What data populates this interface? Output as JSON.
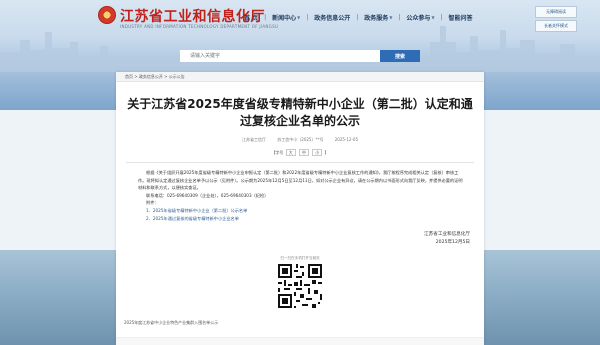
{
  "header": {
    "site_title": "江苏省工业和信息化厅",
    "site_subtitle": "INDUSTRY AND INFORMATION TECHNOLOGY DEPARTMENT OF JIANGSU",
    "nav": [
      {
        "label": "首 页",
        "has_caret": false
      },
      {
        "label": "新闻中心",
        "has_caret": true
      },
      {
        "label": "政务信息公开",
        "has_caret": false
      },
      {
        "label": "政务服务",
        "has_caret": true
      },
      {
        "label": "公众参与",
        "has_caret": true
      },
      {
        "label": "智能问答",
        "has_caret": false
      }
    ],
    "quick_links": [
      "无障碍阅读",
      "长者关怀模式"
    ]
  },
  "search": {
    "placeholder": "请输入关键字",
    "button_label": "搜索"
  },
  "breadcrumb": "首页 > 政务信息公开 > 公示公告",
  "article": {
    "title": "关于江苏省2025年度省级专精特新中小企业（第二批）认定和通过复核企业名单的公示",
    "source": "江苏省工信厅",
    "doc_no": "苏工信中小〔2025〕**号",
    "date": "2025-12-05",
    "font_size_label": "【字号",
    "font_sizes": [
      "大",
      "中",
      "小"
    ],
    "font_size_close": "】",
    "body": [
      "根据《关于组织开展2025年度省级专精特新中小企业申报认定（第二批）和2022年度省级专精特新中小企业复核工作的通知》，我厅按程序完成相关认定（复核）审核工作。现将拟认定通过复核企业名单予以公示（见附件）。公示期为2025年12月5日至12月11日，如对公示企业有异议，请在公示期内以书面形式向我厅反映，并提供必要的证明材料和联系方式，以便核实查证。"
    ],
    "contact": "联系电话：025-69640309（企业处），025-69640303（纪检）",
    "attachments_label": "附件：",
    "attachments": [
      "1．2025年省级专精特新中小企业（第二批）公示名单",
      "2．2025年通过复核的省级专精特新中小企业名单"
    ],
    "signature_org": "江苏省工业和信息化厅",
    "signature_date": "2025年12月5日",
    "qr_caption": "扫一扫在手机打开当前页",
    "footer_note": "2025年度江苏省中小企业特色产业集群入围名单公示"
  }
}
